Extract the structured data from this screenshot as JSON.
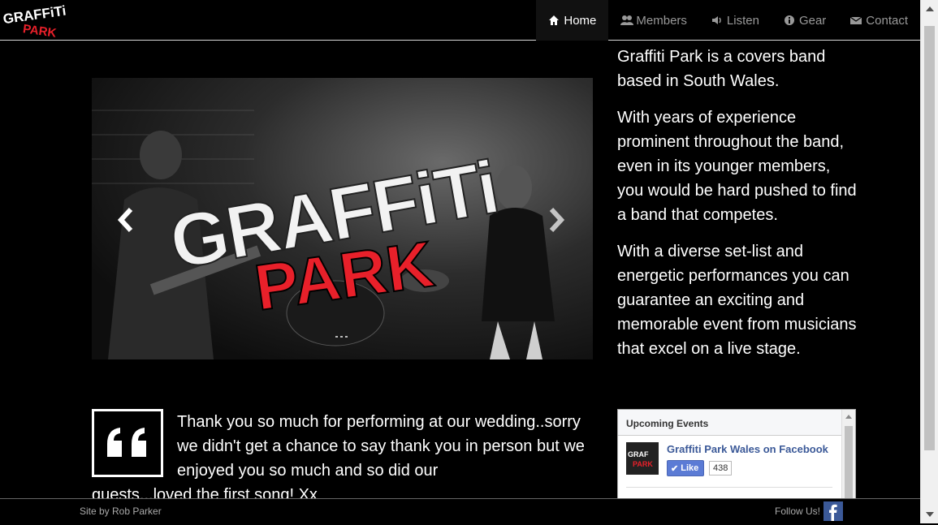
{
  "brand": {
    "logo_top": "GRAFFiTi",
    "logo_bottom": "PARK"
  },
  "nav": {
    "items": [
      {
        "label": "Home",
        "icon": "home-icon",
        "active": true
      },
      {
        "label": "Members",
        "icon": "users-icon",
        "active": false
      },
      {
        "label": "Listen",
        "icon": "volume-icon",
        "active": false
      },
      {
        "label": "Gear",
        "icon": "info-circle-icon",
        "active": false
      },
      {
        "label": "Contact",
        "icon": "envelope-icon",
        "active": false
      }
    ]
  },
  "carousel": {
    "logo_top": "GRAFFiTi",
    "logo_bottom": "PARK",
    "prev_icon": "chevron-left-icon",
    "next_icon": "chevron-right-icon"
  },
  "about": {
    "paragraphs": [
      "Graffiti Park is a covers band based in South Wales.",
      "With years of experience prominent throughout the band, even in its younger members, you would be hard pushed to find a band that competes.",
      "With a diverse set-list and energetic performances you can guarantee an exciting and memorable event from musicians that excel on a live stage."
    ]
  },
  "testimonial": {
    "icon": "quote-left-icon",
    "text": "Thank you so much for performing at our wedding..sorry we didn't get a chance to say thank you in person but we enjoyed you so much and so did our",
    "text_cont": "guests...loved the first song! Xx"
  },
  "facebook_widget": {
    "header": "Upcoming Events",
    "page_name": "Graffiti Park Wales on Facebook",
    "like_label": "Like",
    "like_count": "438"
  },
  "footer": {
    "credit": "Site by Rob Parker",
    "follow": "Follow Us!",
    "follow_icon": "facebook-icon"
  },
  "colors": {
    "accent_red": "#e8202a",
    "fb_blue": "#3b5998"
  }
}
